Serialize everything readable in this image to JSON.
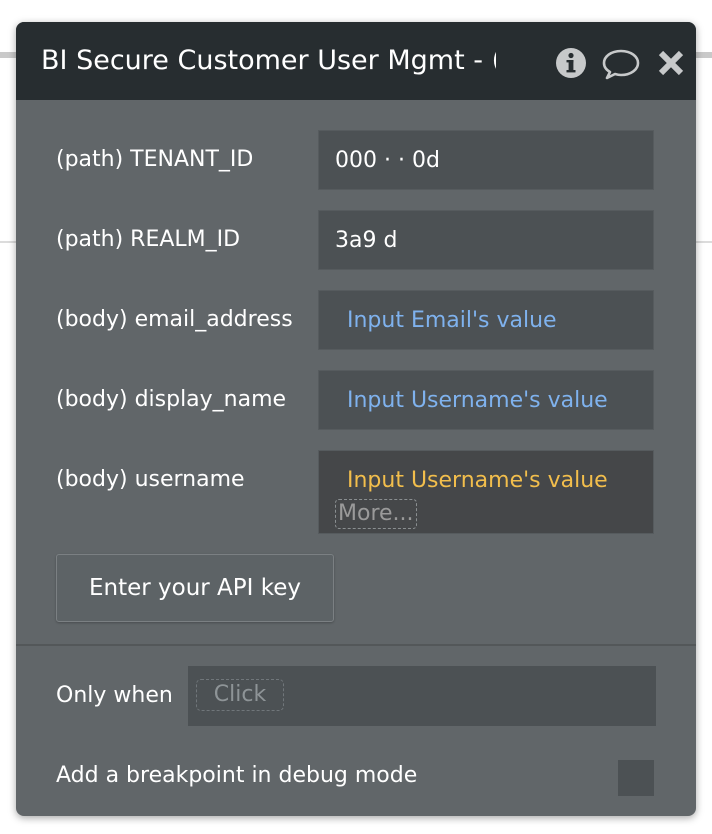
{
  "dialog": {
    "title": "BI Secure Customer User Mgmt - (",
    "icons": [
      "info-icon",
      "comment-icon",
      "close-icon"
    ]
  },
  "params": [
    {
      "label": "(path) TENANT_ID",
      "value": "000     ·    ·  0d",
      "style": "plain"
    },
    {
      "label": "(path) REALM_ID",
      "value": "3a9              d",
      "style": "plain"
    },
    {
      "label": "(body) email_address",
      "value": "Input Email's value",
      "style": "dynamic"
    },
    {
      "label": "(body) display_name",
      "value": "Input Username's value",
      "style": "dynamic"
    },
    {
      "label": "(body) username",
      "value": "Input Username's value",
      "style": "dynamic-highlight",
      "more": "More..."
    }
  ],
  "api_button": "Enter your API key",
  "only_when": {
    "label": "Only when",
    "placeholder": "Click"
  },
  "breakpoint": {
    "label": "Add a breakpoint in debug mode",
    "checked": false
  },
  "colors": {
    "panel": "#616669",
    "titlebar": "#272d30",
    "field": "#4c5154",
    "dynamic_blue": "#7fb2ee",
    "highlight_gold": "#f2be4c"
  }
}
